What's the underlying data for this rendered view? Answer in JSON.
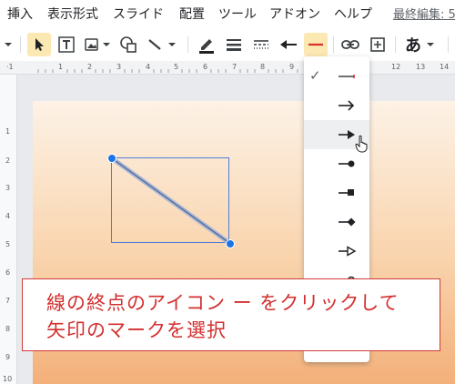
{
  "menubar": {
    "items": [
      "挿入",
      "表示形式",
      "スライド",
      "配置",
      "ツール",
      "アドオン",
      "ヘルプ"
    ],
    "last_edit": "最終編集: 5"
  },
  "toolbar": {
    "text_style_label": "あ",
    "icons": [
      "chevron-down",
      "select-arrow",
      "text-box",
      "image",
      "shape",
      "line",
      "pen-color",
      "line-weight",
      "line-dash",
      "line-start",
      "line-end",
      "link",
      "comment-add",
      "text-style"
    ]
  },
  "ruler": {
    "horizontal": [
      "1",
      "1",
      "2",
      "3",
      "4",
      "5",
      "6",
      "7",
      "8",
      "9",
      "12",
      "13",
      "14"
    ],
    "vertical": [
      "1",
      "2",
      "3",
      "4",
      "5",
      "6",
      "7",
      "8",
      "9",
      "10"
    ]
  },
  "line_end_menu": {
    "selected_index": 0,
    "hover_index": 2,
    "options": [
      "none",
      "arrow",
      "filled-arrow",
      "filled-circle",
      "filled-square",
      "filled-diamond",
      "outline-arrow",
      "outline-circle"
    ]
  },
  "annotation": {
    "line1": "線の終点のアイコン ー をクリックして",
    "line2": "矢印のマークを選択"
  },
  "colors": {
    "accent": "#1a73e8",
    "annotation_text": "#d32f2f",
    "line_end_icon": "#d93025"
  }
}
